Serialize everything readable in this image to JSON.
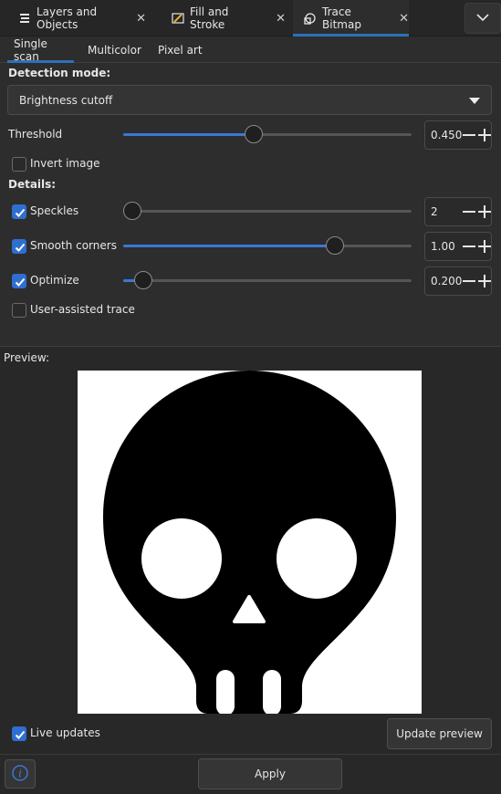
{
  "dock_tabs": [
    {
      "label": "Layers and Objects",
      "icon": "layers-icon"
    },
    {
      "label": "Fill and Stroke",
      "icon": "fill-stroke-icon"
    },
    {
      "label": "Trace Bitmap",
      "icon": "trace-bitmap-icon"
    }
  ],
  "active_dock_tab": "Trace Bitmap",
  "sub_tabs": [
    {
      "label": "Single scan"
    },
    {
      "label": "Multicolor"
    },
    {
      "label": "Pixel art"
    }
  ],
  "active_sub_tab": "Single scan",
  "detection": {
    "label": "Detection mode:",
    "selected": "Brightness cutoff"
  },
  "threshold": {
    "label": "Threshold",
    "value": "0.450",
    "fraction": 0.45
  },
  "invert": {
    "label": "Invert image",
    "checked": false
  },
  "details_label": "Details:",
  "speckles": {
    "label": "Speckles",
    "value": "2",
    "fraction": 0.0,
    "checked": true
  },
  "smooth": {
    "label": "Smooth corners",
    "value": "1.00",
    "fraction": 0.75,
    "checked": true
  },
  "optimize": {
    "label": "Optimize",
    "value": "0.200",
    "fraction": 0.04,
    "checked": true
  },
  "user_assisted": {
    "label": "User-assisted trace",
    "checked": false
  },
  "preview_label": "Preview:",
  "live_updates": {
    "label": "Live updates",
    "checked": true
  },
  "update_preview_label": "Update preview",
  "apply_label": "Apply",
  "accent_color": "#2f6fb8"
}
